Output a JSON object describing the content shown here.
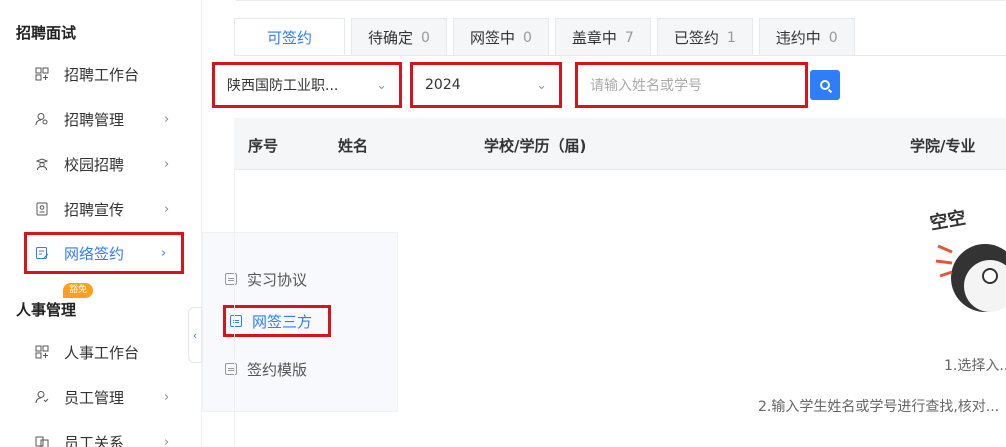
{
  "sidebar": {
    "section_recruit": "招聘面试",
    "section_hr": "人事管理",
    "badge": "豁免",
    "items": [
      {
        "label": "招聘工作台",
        "icon": "grid-icon",
        "chevron": false
      },
      {
        "label": "招聘管理",
        "icon": "user-search-icon",
        "chevron": true
      },
      {
        "label": "校园招聘",
        "icon": "campus-user-icon",
        "chevron": true
      },
      {
        "label": "招聘宣传",
        "icon": "poster-icon",
        "chevron": true
      },
      {
        "label": "网络签约",
        "icon": "edit-doc-icon",
        "chevron": true,
        "active": true
      },
      {
        "label": "人事工作台",
        "icon": "grid-icon",
        "chevron": false
      },
      {
        "label": "员工管理",
        "icon": "user-manage-icon",
        "chevron": true
      },
      {
        "label": "员工关系",
        "icon": "relation-icon",
        "chevron": true
      }
    ]
  },
  "submenu": {
    "items": [
      {
        "label": "实习协议"
      },
      {
        "label": "网签三方",
        "active": true
      },
      {
        "label": "签约模版"
      }
    ]
  },
  "tabs": [
    {
      "label": "可签约",
      "count": ""
    },
    {
      "label": "待确定",
      "count": "0"
    },
    {
      "label": "网签中",
      "count": "0"
    },
    {
      "label": "盖章中",
      "count": "7"
    },
    {
      "label": "已签约",
      "count": "1"
    },
    {
      "label": "违约中",
      "count": "0"
    }
  ],
  "filters": {
    "school_value": "陕西国防工业职...",
    "year_value": "2024",
    "search_placeholder": "请输入姓名或学号"
  },
  "table": {
    "headers": [
      "序号",
      "姓名",
      "学校/学历（届)",
      "学院/专业"
    ]
  },
  "empty": {
    "illustration_text": "空空",
    "line1": "1.选择入...",
    "line2": "2.输入学生姓名或学号进行查找,核对..."
  },
  "colors": {
    "accent": "#2d7ef8",
    "highlight_border": "#d8141b",
    "badge": "#ff9f1a"
  }
}
